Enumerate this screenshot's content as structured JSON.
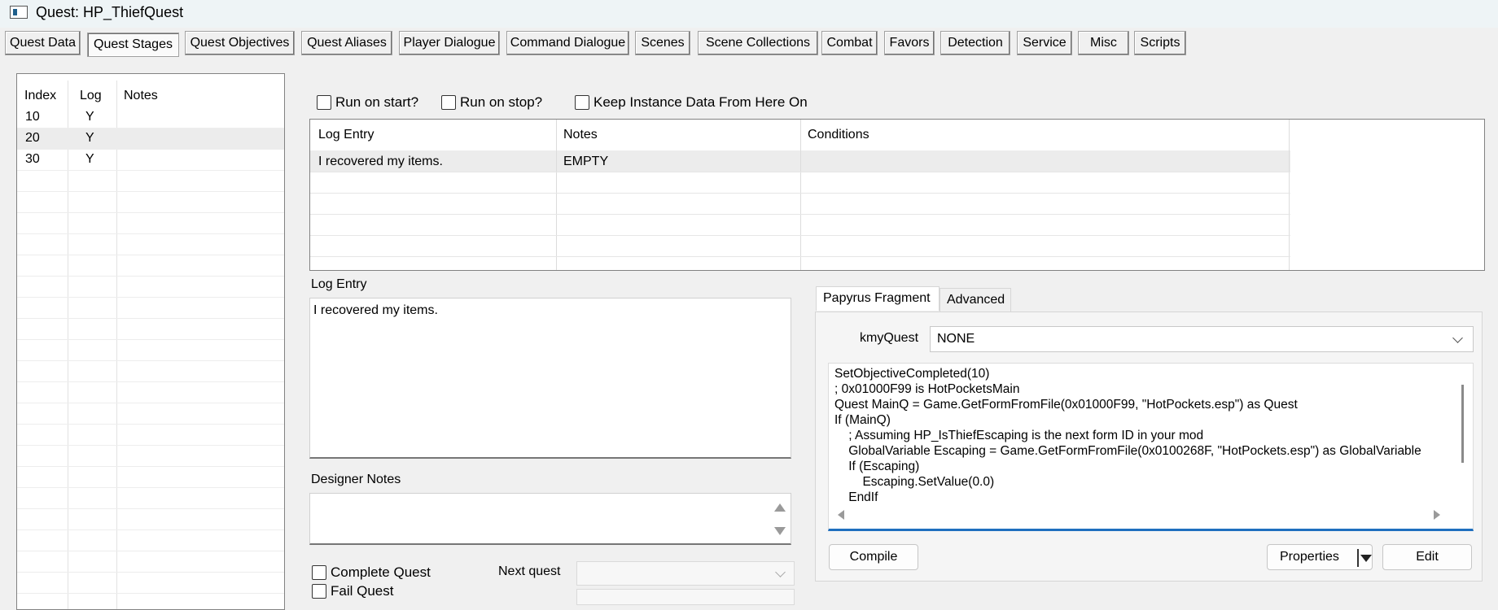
{
  "window": {
    "title": "Quest: HP_ThiefQuest"
  },
  "tabs": [
    {
      "label": "Quest Data"
    },
    {
      "label": "Quest Stages"
    },
    {
      "label": "Quest Objectives"
    },
    {
      "label": "Quest Aliases"
    },
    {
      "label": "Player Dialogue"
    },
    {
      "label": "Command Dialogue"
    },
    {
      "label": "Scenes"
    },
    {
      "label": "Scene Collections"
    },
    {
      "label": "Combat"
    },
    {
      "label": "Favors"
    },
    {
      "label": "Detection"
    },
    {
      "label": "Service"
    },
    {
      "label": "Misc"
    },
    {
      "label": "Scripts"
    }
  ],
  "active_tab": "Quest Stages",
  "stages": {
    "columns": [
      "Index",
      "Log",
      "Notes"
    ],
    "rows": [
      {
        "index": "10",
        "log": "Y",
        "notes": ""
      },
      {
        "index": "20",
        "log": "Y",
        "notes": ""
      },
      {
        "index": "30",
        "log": "Y",
        "notes": ""
      }
    ],
    "selected_index": "20"
  },
  "options": {
    "run_on_start": "Run on start?",
    "run_on_stop": "Run on stop?",
    "keep_instance": "Keep Instance Data From Here On"
  },
  "log_grid": {
    "columns": [
      "Log Entry",
      "Notes",
      "Conditions"
    ],
    "rows": [
      {
        "log_entry": "I recovered my items.",
        "notes": "EMPTY",
        "conditions": ""
      }
    ]
  },
  "log_entry": {
    "label": "Log Entry",
    "text": "I recovered my items."
  },
  "designer_notes": {
    "label": "Designer Notes",
    "text": ""
  },
  "complete_quest": "Complete Quest",
  "fail_quest": "Fail Quest",
  "next_quest": {
    "label": "Next quest",
    "value": ""
  },
  "papyrus": {
    "tabs": [
      "Papyrus Fragment",
      "Advanced"
    ],
    "kmy_label": "kmyQuest",
    "kmy_value": "NONE",
    "code_lines": [
      "SetObjectiveCompleted(10)",
      "; 0x01000F99 is HotPocketsMain",
      "Quest MainQ = Game.GetFormFromFile(0x01000F99, \"HotPockets.esp\") as Quest",
      "If (MainQ)",
      "    ; Assuming HP_IsThiefEscaping is the next form ID in your mod",
      "    GlobalVariable Escaping = Game.GetFormFromFile(0x0100268F, \"HotPockets.esp\") as GlobalVariable",
      "    If (Escaping)",
      "        Escaping.SetValue(0.0)",
      "    EndIf"
    ],
    "compile": "Compile",
    "properties": "Properties",
    "edit": "Edit"
  }
}
